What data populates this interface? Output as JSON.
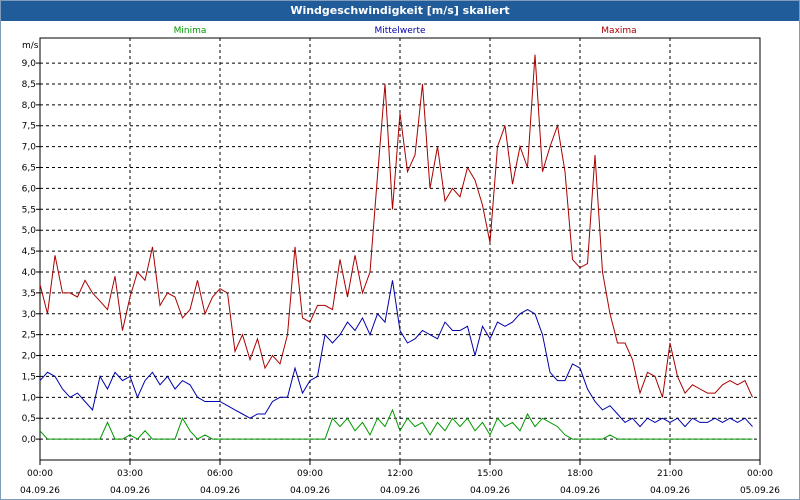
{
  "window": {
    "title": "Windgeschwindigkeit [m/s] skaliert"
  },
  "chart_data": {
    "type": "line",
    "title": "Windgeschwindigkeit [m/s] skaliert",
    "ylabel": "m/s",
    "ylim": [
      -0.5,
      9.6
    ],
    "xlim": [
      0,
      24
    ],
    "grid": true,
    "legend_position": "top",
    "y_ticks": [
      "0,0",
      "0,5",
      "1,0",
      "1,5",
      "2,0",
      "2,5",
      "3,0",
      "3,5",
      "4,0",
      "4,5",
      "5,0",
      "5,5",
      "6,0",
      "6,5",
      "7,0",
      "7,5",
      "8,0",
      "8,5",
      "9,0"
    ],
    "x_ticks": [
      {
        "time": "00:00",
        "date": "04.09.26"
      },
      {
        "time": "03:00",
        "date": "04.09.26"
      },
      {
        "time": "06:00",
        "date": "04.09.26"
      },
      {
        "time": "09:00",
        "date": "04.09.26"
      },
      {
        "time": "12:00",
        "date": "04.09.26"
      },
      {
        "time": "15:00",
        "date": "04.09.26"
      },
      {
        "time": "18:00",
        "date": "04.09.26"
      },
      {
        "time": "21:00",
        "date": "04.09.26"
      },
      {
        "time": "00:00",
        "date": "05.09.26"
      }
    ],
    "series": [
      {
        "name": "Minima",
        "color": "#009900",
        "x": [
          0,
          0.25,
          0.5,
          0.75,
          1,
          1.25,
          1.5,
          1.75,
          2,
          2.25,
          2.5,
          2.75,
          3,
          3.25,
          3.5,
          3.75,
          4,
          4.25,
          4.5,
          4.75,
          5,
          5.25,
          5.5,
          5.75,
          6,
          6.25,
          6.5,
          6.75,
          7,
          7.25,
          7.5,
          7.75,
          8,
          8.25,
          8.5,
          8.75,
          9,
          9.25,
          9.5,
          9.75,
          10,
          10.25,
          10.5,
          10.75,
          11,
          11.25,
          11.5,
          11.75,
          12,
          12.25,
          12.5,
          12.75,
          13,
          13.25,
          13.5,
          13.75,
          14,
          14.25,
          14.5,
          14.75,
          15,
          15.25,
          15.5,
          15.75,
          16,
          16.25,
          16.5,
          16.75,
          17,
          17.25,
          17.5,
          17.75,
          18,
          18.25,
          18.5,
          18.75,
          19,
          19.25,
          19.5,
          19.75,
          20,
          20.25,
          20.5,
          20.75,
          21,
          21.25,
          21.5,
          21.75,
          22,
          22.25,
          22.5,
          22.75,
          23,
          23.25,
          23.5,
          23.75
        ],
        "values": [
          0.2,
          0,
          0,
          0,
          0,
          0,
          0,
          0,
          0,
          0.4,
          0,
          0,
          0.1,
          0,
          0.2,
          0,
          0,
          0,
          0,
          0.5,
          0.2,
          0,
          0.1,
          0,
          0,
          0,
          0,
          0,
          0,
          0,
          0,
          0,
          0,
          0,
          0,
          0,
          0,
          0,
          0,
          0.5,
          0.3,
          0.5,
          0.2,
          0.4,
          0.1,
          0.5,
          0.3,
          0.7,
          0.2,
          0.5,
          0.3,
          0.4,
          0.1,
          0.4,
          0.2,
          0.5,
          0.3,
          0.5,
          0.2,
          0.4,
          0.1,
          0.5,
          0.3,
          0.4,
          0.2,
          0.6,
          0.3,
          0.5,
          0.4,
          0.3,
          0.1,
          0,
          0,
          0,
          0,
          0,
          0.1,
          0,
          0,
          0,
          0,
          0,
          0,
          0,
          0,
          0,
          0,
          0,
          0,
          0,
          0,
          0,
          0,
          0,
          0,
          0
        ],
        "label_x": 5
      },
      {
        "name": "Mittelwerte",
        "color": "#0000aa",
        "x": [
          0,
          0.25,
          0.5,
          0.75,
          1,
          1.25,
          1.5,
          1.75,
          2,
          2.25,
          2.5,
          2.75,
          3,
          3.25,
          3.5,
          3.75,
          4,
          4.25,
          4.5,
          4.75,
          5,
          5.25,
          5.5,
          5.75,
          6,
          6.25,
          6.5,
          6.75,
          7,
          7.25,
          7.5,
          7.75,
          8,
          8.25,
          8.5,
          8.75,
          9,
          9.25,
          9.5,
          9.75,
          10,
          10.25,
          10.5,
          10.75,
          11,
          11.25,
          11.5,
          11.75,
          12,
          12.25,
          12.5,
          12.75,
          13,
          13.25,
          13.5,
          13.75,
          14,
          14.25,
          14.5,
          14.75,
          15,
          15.25,
          15.5,
          15.75,
          16,
          16.25,
          16.5,
          16.75,
          17,
          17.25,
          17.5,
          17.75,
          18,
          18.25,
          18.5,
          18.75,
          19,
          19.25,
          19.5,
          19.75,
          20,
          20.25,
          20.5,
          20.75,
          21,
          21.25,
          21.5,
          21.75,
          22,
          22.25,
          22.5,
          22.75,
          23,
          23.25,
          23.5,
          23.75
        ],
        "values": [
          1.4,
          1.6,
          1.5,
          1.2,
          1.0,
          1.1,
          0.9,
          0.7,
          1.5,
          1.2,
          1.6,
          1.4,
          1.5,
          1.0,
          1.4,
          1.6,
          1.3,
          1.5,
          1.2,
          1.4,
          1.3,
          1.0,
          0.9,
          0.9,
          0.9,
          0.8,
          0.7,
          0.6,
          0.5,
          0.6,
          0.6,
          0.9,
          1.0,
          1.0,
          1.7,
          1.1,
          1.4,
          1.5,
          2.5,
          2.3,
          2.5,
          2.8,
          2.6,
          2.9,
          2.5,
          3.0,
          2.8,
          3.8,
          2.6,
          2.3,
          2.4,
          2.6,
          2.5,
          2.4,
          2.8,
          2.6,
          2.6,
          2.7,
          2.0,
          2.7,
          2.4,
          2.8,
          2.7,
          2.8,
          3.0,
          3.1,
          3.0,
          2.5,
          1.6,
          1.4,
          1.4,
          1.8,
          1.7,
          1.2,
          0.9,
          0.7,
          0.8,
          0.6,
          0.4,
          0.5,
          0.3,
          0.5,
          0.4,
          0.5,
          0.4,
          0.5,
          0.3,
          0.5,
          0.4,
          0.4,
          0.5,
          0.4,
          0.5,
          0.4,
          0.5,
          0.3
        ],
        "label_x": 12
      },
      {
        "name": "Maxima",
        "color": "#aa0000",
        "x": [
          0,
          0.25,
          0.5,
          0.75,
          1,
          1.25,
          1.5,
          1.75,
          2,
          2.25,
          2.5,
          2.75,
          3,
          3.25,
          3.5,
          3.75,
          4,
          4.25,
          4.5,
          4.75,
          5,
          5.25,
          5.5,
          5.75,
          6,
          6.25,
          6.5,
          6.75,
          7,
          7.25,
          7.5,
          7.75,
          8,
          8.25,
          8.5,
          8.75,
          9,
          9.25,
          9.5,
          9.75,
          10,
          10.25,
          10.5,
          10.75,
          11,
          11.25,
          11.5,
          11.75,
          12,
          12.25,
          12.5,
          12.75,
          13,
          13.25,
          13.5,
          13.75,
          14,
          14.25,
          14.5,
          14.75,
          15,
          15.25,
          15.5,
          15.75,
          16,
          16.25,
          16.5,
          16.75,
          17,
          17.25,
          17.5,
          17.75,
          18,
          18.25,
          18.5,
          18.75,
          19,
          19.25,
          19.5,
          19.75,
          20,
          20.25,
          20.5,
          20.75,
          21,
          21.25,
          21.5,
          21.75,
          22,
          22.25,
          22.5,
          22.75,
          23,
          23.25,
          23.5,
          23.75
        ],
        "values": [
          3.7,
          3.0,
          4.4,
          3.5,
          3.5,
          3.4,
          3.8,
          3.5,
          3.3,
          3.1,
          3.9,
          2.6,
          3.4,
          4.0,
          3.8,
          4.6,
          3.2,
          3.5,
          3.4,
          2.9,
          3.1,
          3.8,
          3.0,
          3.4,
          3.6,
          3.5,
          2.1,
          2.5,
          1.9,
          2.4,
          1.7,
          2.0,
          1.8,
          2.5,
          4.6,
          2.9,
          2.8,
          3.2,
          3.2,
          3.1,
          4.3,
          3.4,
          4.4,
          3.5,
          4.0,
          6.3,
          8.5,
          5.5,
          7.8,
          6.4,
          6.8,
          8.5,
          6.0,
          7.0,
          5.7,
          6.0,
          5.8,
          6.5,
          6.2,
          5.6,
          4.7,
          7.0,
          7.5,
          6.1,
          7.0,
          6.5,
          9.2,
          6.4,
          7.0,
          7.5,
          6.4,
          4.3,
          4.1,
          4.2,
          6.8,
          4.0,
          3.0,
          2.3,
          2.3,
          1.9,
          1.1,
          1.6,
          1.5,
          1.0,
          2.3,
          1.5,
          1.1,
          1.3,
          1.2,
          1.1,
          1.1,
          1.3,
          1.4,
          1.3,
          1.4,
          1.0
        ],
        "label_x": 19.3
      }
    ]
  }
}
